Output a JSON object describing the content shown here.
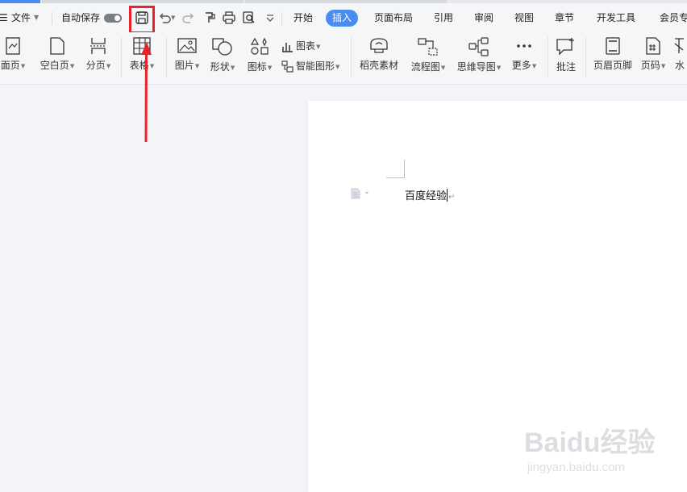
{
  "quick_access": {
    "menu_label": "文件",
    "autosave_label": "自动保存"
  },
  "tabs": [
    "开始",
    "插入",
    "页面布局",
    "引用",
    "审阅",
    "视图",
    "章节",
    "开发工具",
    "会员专"
  ],
  "active_tab": "插入",
  "ribbon": {
    "cover_page": "面页",
    "blank_page": "空白页",
    "page_break": "分页",
    "table": "表格",
    "picture": "图片",
    "shape": "形状",
    "icon": "图标",
    "chart": "图表",
    "smart_art": "智能图形",
    "material": "稻壳素材",
    "flowchart": "流程图",
    "mind_map": "思维导图",
    "more": "更多",
    "comment": "批注",
    "header_footer": "页眉页脚",
    "page_number": "页码",
    "watermark": "水"
  },
  "document": {
    "text": "百度经验"
  },
  "watermark": {
    "brand": "Baidu经验",
    "url": "jingyan.baidu.com"
  },
  "colors": {
    "accent": "#4a8cf0",
    "annotation": "#e8222a"
  }
}
